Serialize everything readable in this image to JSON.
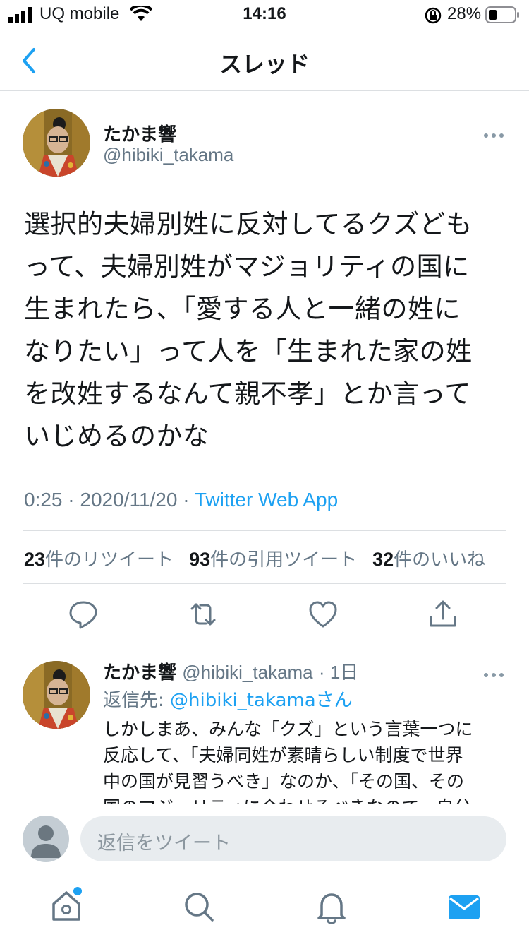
{
  "status_bar": {
    "carrier": "UQ mobile",
    "time": "14:16",
    "battery": "28%"
  },
  "nav": {
    "title": "スレッド"
  },
  "tweet": {
    "name": "たかま響",
    "handle": "@hibiki_takama",
    "lines": [
      "選択的夫婦別姓に反対してるクズども",
      "って、夫婦別姓がマジョリティの国に",
      "生まれたら、「愛する人と一緒の姓に",
      "なりたい」って人を「生まれた家の姓",
      "を改姓するなんて親不孝」とか言って",
      "いじめるのかな"
    ],
    "time": "0:25",
    "date": "2020/11/20",
    "source": "Twitter Web App",
    "retweets_count": "23",
    "retweets_label": "件のリツイート",
    "quotes_count": "93",
    "quotes_label": "件の引用ツイート",
    "likes_count": "32",
    "likes_label": "件のいいね"
  },
  "reply": {
    "name": "たかま響",
    "handle": "@hibiki_takama",
    "age": "1日",
    "reply_to_label": "返信先: ",
    "reply_to_handle": "@hibiki_takama",
    "reply_to_suffix": "さん",
    "lines": [
      "しかしまあ、みんな「クズ」という言葉一つに",
      "反応して、「夫婦同姓が素晴らしい制度で世界",
      "中の国が見習うべき」なのか、「その国、その",
      "国のマジョリティに合わせるべきなので、自分"
    ]
  },
  "composer": {
    "placeholder": "返信をツイート"
  },
  "colors": {
    "accent": "#1da1f2",
    "muted": "#657786",
    "text": "#14171a"
  }
}
